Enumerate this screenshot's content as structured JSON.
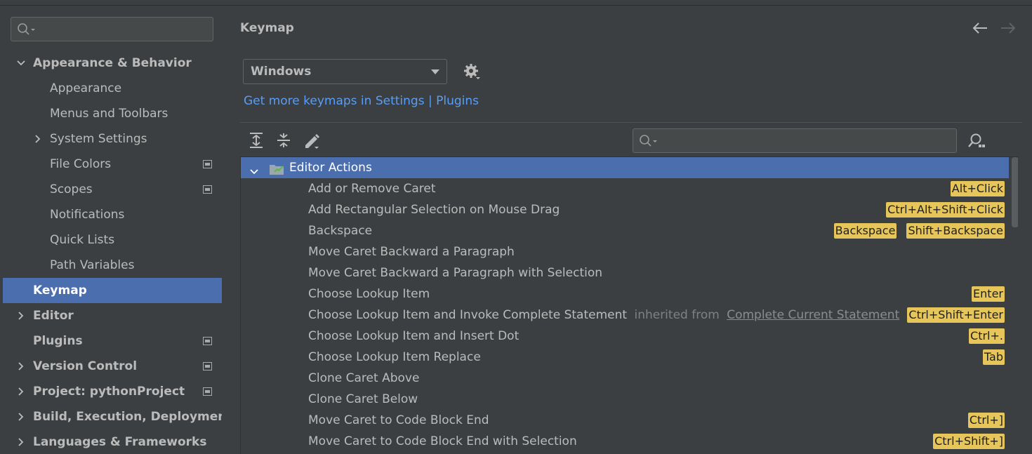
{
  "sidebar": {
    "search_placeholder": "",
    "items": [
      {
        "label": "Appearance & Behavior",
        "level": 0,
        "expand": "open",
        "bold": true
      },
      {
        "label": "Appearance",
        "level": 1
      },
      {
        "label": "Menus and Toolbars",
        "level": 1
      },
      {
        "label": "System Settings",
        "level": 1,
        "expand": "closed"
      },
      {
        "label": "File Colors",
        "level": 1,
        "project": true
      },
      {
        "label": "Scopes",
        "level": 1,
        "project": true
      },
      {
        "label": "Notifications",
        "level": 1
      },
      {
        "label": "Quick Lists",
        "level": 1
      },
      {
        "label": "Path Variables",
        "level": 1
      },
      {
        "label": "Keymap",
        "level": 0,
        "bold": true,
        "selected": true
      },
      {
        "label": "Editor",
        "level": 0,
        "expand": "closed",
        "bold": true
      },
      {
        "label": "Plugins",
        "level": 0,
        "bold": true,
        "project": true
      },
      {
        "label": "Version Control",
        "level": 0,
        "expand": "closed",
        "bold": true,
        "project": true
      },
      {
        "label": "Project: pythonProject",
        "level": 0,
        "expand": "closed",
        "bold": true,
        "project": true
      },
      {
        "label": "Build, Execution, Deployment",
        "level": 0,
        "expand": "closed",
        "bold": true
      },
      {
        "label": "Languages & Frameworks",
        "level": 0,
        "expand": "closed",
        "bold": true
      }
    ]
  },
  "main": {
    "title": "Keymap",
    "keymap_value": "Windows",
    "link": "Get more keymaps in Settings | Plugins",
    "search_placeholder": ""
  },
  "table": {
    "header": "Editor Actions",
    "rows": [
      {
        "label": "Add or Remove Caret",
        "shortcuts": [
          "Alt+Click"
        ]
      },
      {
        "label": "Add Rectangular Selection on Mouse Drag",
        "shortcuts": [
          "Ctrl+Alt+Shift+Click"
        ]
      },
      {
        "label": "Backspace",
        "shortcuts": [
          "Backspace",
          "Shift+Backspace"
        ]
      },
      {
        "label": "Move Caret Backward a Paragraph",
        "shortcuts": []
      },
      {
        "label": "Move Caret Backward a Paragraph with Selection",
        "shortcuts": []
      },
      {
        "label": "Choose Lookup Item",
        "shortcuts": [
          "Enter"
        ]
      },
      {
        "label": "Choose Lookup Item and Invoke Complete Statement",
        "inherited_prefix": "inherited from",
        "inherited_link": "Complete Current Statement",
        "shortcuts": [
          "Ctrl+Shift+Enter"
        ]
      },
      {
        "label": "Choose Lookup Item and Insert Dot",
        "shortcuts": [
          "Ctrl+."
        ]
      },
      {
        "label": "Choose Lookup Item Replace",
        "shortcuts": [
          "Tab"
        ]
      },
      {
        "label": "Clone Caret Above",
        "shortcuts": []
      },
      {
        "label": "Clone Caret Below",
        "shortcuts": []
      },
      {
        "label": "Move Caret to Code Block End",
        "shortcuts": [
          "Ctrl+]"
        ]
      },
      {
        "label": "Move Caret to Code Block End with Selection",
        "shortcuts": [
          "Ctrl+Shift+]"
        ]
      }
    ]
  }
}
